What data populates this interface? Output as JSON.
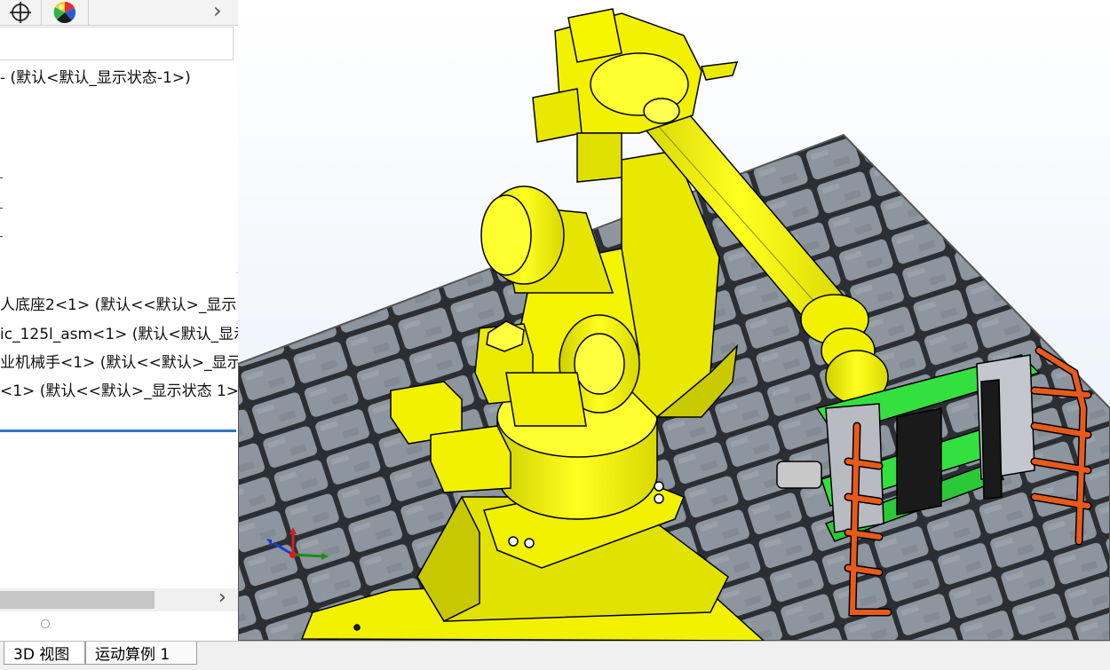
{
  "panel": {
    "tabs": [
      {
        "icon": "crosshair-icon"
      },
      {
        "icon": "appearance-ball-icon"
      }
    ],
    "expand_arrow": "›",
    "tree": {
      "root_config": "-  (默认<默认_显示状态-1>)",
      "item1": "人底座2<1> (默认<<默认>_显示",
      "item2": "ic_125l_asm<1> (默认<默认_显示",
      "item3": "业机械手<1> (默认<<默认>_显示",
      "item4": "<1> (默认<<默认>_显示状态 1>)"
    },
    "hscroll_arrow": "›"
  },
  "bottom_tabs": [
    "3D 视图",
    "运动算例 1"
  ],
  "colors": {
    "robot_yellow": "#f2f200",
    "gripper_orange": "#e85a1c",
    "frame_green": "#33e040",
    "floor_stone": "#8d959e",
    "selection_blue": "#2e75c6"
  }
}
